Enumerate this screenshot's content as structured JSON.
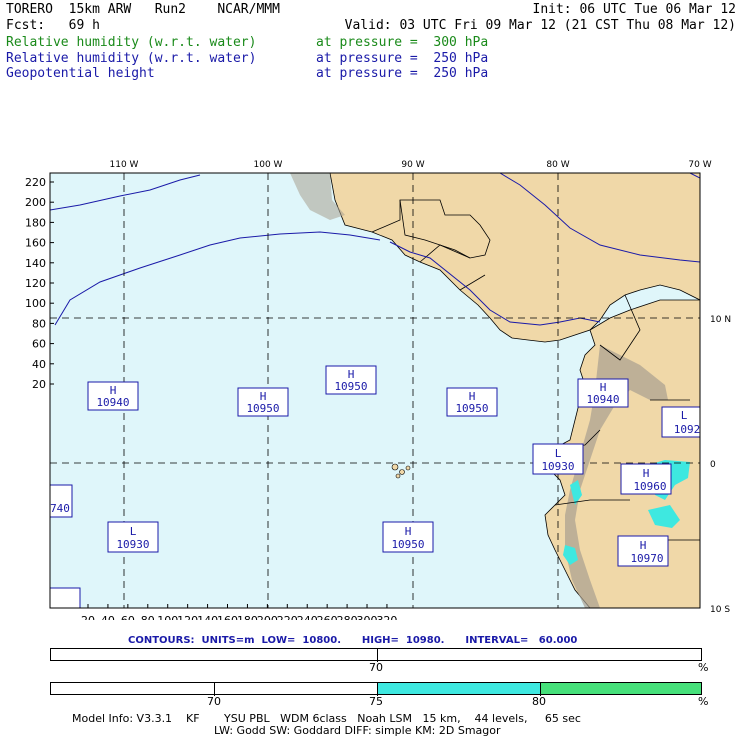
{
  "header": {
    "left1": "TORERO  15km ARW   Run2    NCAR/MMM",
    "left2": "Fcst:   69 h",
    "right1": "Init: 06 UTC Tue 06 Mar 12",
    "right2": "Valid: 03 UTC Fri 09 Mar 12 (21 CST Thu 08 Mar 12)",
    "fields": [
      {
        "name": "Relative humidity (w.r.t. water)",
        "level": "at pressure =  300 hPa",
        "color": "#1a8a1a"
      },
      {
        "name": "Relative humidity (w.r.t. water)",
        "level": "at pressure =  250 hPa",
        "color": "#1a1aa8"
      },
      {
        "name": "Geopotential height",
        "level": "at pressure =  250 hPa",
        "color": "#1a1aa8"
      }
    ]
  },
  "map": {
    "lon_labels": [
      "110 W",
      "100 W",
      "90 W",
      "80 W",
      "70 W"
    ],
    "lat_labels": [
      "10 N",
      "0",
      "10 S"
    ],
    "y_ticks": [
      "220",
      "200",
      "180",
      "160",
      "140",
      "120",
      "100",
      "80",
      "60",
      "40",
      "20"
    ],
    "x_ticks": [
      "20",
      "40",
      "60",
      "80",
      "100",
      "120",
      "140",
      "160",
      "180",
      "200",
      "220",
      "240",
      "260",
      "280",
      "300",
      "320"
    ],
    "colors": {
      "ocean": "#dff6fa",
      "land": "#f0d8a8",
      "mountain": "#a8a090",
      "rh_high": "#3ee8e0",
      "contour": "#1a1aa8"
    },
    "centers": [
      {
        "type": "H",
        "value": "10940"
      },
      {
        "type": "H",
        "value": "10950"
      },
      {
        "type": "H",
        "value": "10950"
      },
      {
        "type": "H",
        "value": "10950"
      },
      {
        "type": "H",
        "value": "10940"
      },
      {
        "type": "L",
        "value": "1092"
      },
      {
        "type": "L",
        "value": "10930"
      },
      {
        "type": "H",
        "value": "10960"
      },
      {
        "type": "L",
        "value": "10930"
      },
      {
        "type": "H",
        "value": "10950"
      },
      {
        "type": "H",
        "value": "10970"
      },
      {
        "type": "",
        "value": "740"
      }
    ]
  },
  "contours_text": "CONTOURS:  UNITS=m  LOW=  10800.      HIGH=  10980.      INTERVAL=   60.000",
  "bars": {
    "bar1": {
      "tick_label": "70",
      "unit": "%"
    },
    "bar2": {
      "labels": [
        "70",
        "75",
        "80"
      ],
      "unit": "%",
      "fills": [
        {
          "from": "75",
          "to": "80",
          "color": "#3ee8e0"
        },
        {
          "from": "80",
          "to": "",
          "color": "#46e07a"
        }
      ]
    }
  },
  "footer": {
    "line1": "Model Info: V3.3.1    KF       YSU PBL   WDM 6class   Noah LSM   15 km,    44 levels,     65 sec",
    "line2": "LW: Godd SW: Goddard DIFF: simple KM: 2D Smagor"
  }
}
